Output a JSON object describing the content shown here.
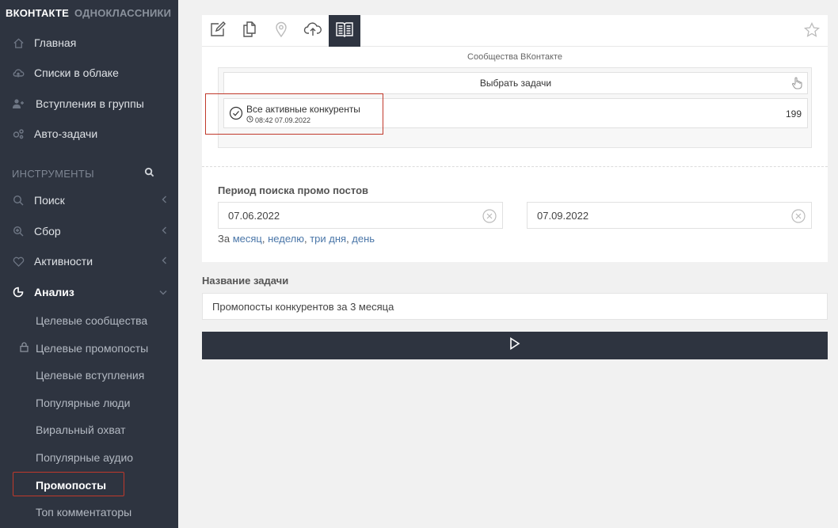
{
  "brand": {
    "primary": "ВКОНТАКТЕ",
    "secondary": "ОДНОКЛАССНИКИ"
  },
  "nav": {
    "items": [
      {
        "label": "Главная",
        "icon": "home-icon"
      },
      {
        "label": "Списки в облаке",
        "icon": "cloud-icon"
      },
      {
        "label": "Вступления в группы",
        "icon": "users-icon"
      },
      {
        "label": "Авто-задачи",
        "icon": "gears-icon"
      }
    ],
    "tools_title": "ИНСТРУМЕНТЫ",
    "tools": [
      {
        "label": "Поиск",
        "icon": "search-icon"
      },
      {
        "label": "Сбор",
        "icon": "zoom-plus-icon"
      },
      {
        "label": "Активности",
        "icon": "heart-icon"
      },
      {
        "label": "Анализ",
        "icon": "chart-icon"
      }
    ],
    "submenu": [
      "Целевые сообщества",
      "Целевые промопосты",
      "Целевые вступления",
      "Популярные люди",
      "Виральный охват",
      "Популярные аудио",
      "Промопосты",
      "Топ комментаторы"
    ]
  },
  "panel": {
    "groups_caption": "Сообщества ВКонтакте",
    "select_tasks": "Выбрать задачи",
    "task": {
      "name": "Все активные конкуренты",
      "time": "08:42 07.09.2022",
      "count": "199"
    },
    "period_label": "Период поиска промо постов",
    "date_from": "07.06.2022",
    "date_to": "07.09.2022",
    "quick": {
      "prefix": "За",
      "month": "месяц",
      "week": "неделю",
      "three_days": "три дня",
      "day": "день"
    }
  },
  "task_name": {
    "label": "Название задачи",
    "value": "Промопосты конкурентов за 3 месяца"
  },
  "colors": {
    "sidebar": "#2e3440",
    "accent_link": "#4a76a8",
    "highlight": "#c0392b"
  }
}
